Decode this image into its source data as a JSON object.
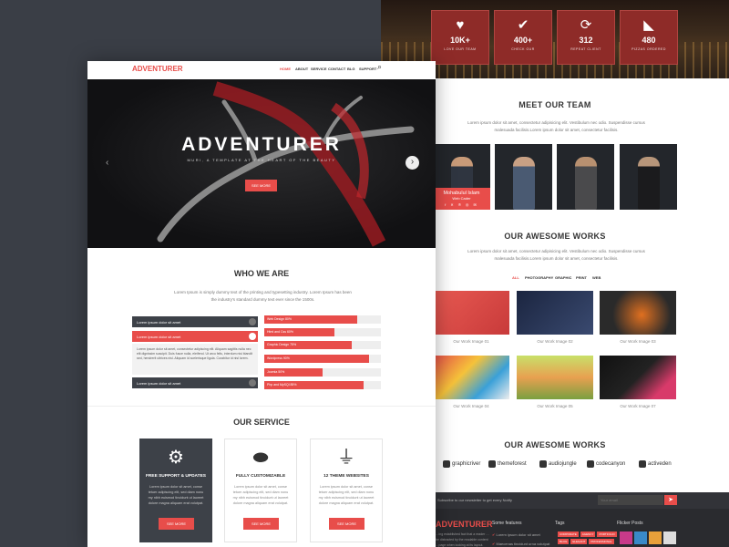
{
  "stats": [
    {
      "icon": "heart-icon",
      "glyph": "♥",
      "value": "10K+",
      "label": "LOVE OUR TEAM"
    },
    {
      "icon": "check-icon",
      "glyph": "✔",
      "value": "400+",
      "label": "CHECK OUR"
    },
    {
      "icon": "refresh-icon",
      "glyph": "⟳",
      "value": "312",
      "label": "REPEAT CLIENT"
    },
    {
      "icon": "pizza-icon",
      "glyph": "◣",
      "value": "480",
      "label": "PIZZAS ORDERED"
    }
  ],
  "team": {
    "title": "MEET OUR TEAM",
    "text": "Lorem ipsum dolor sit amet, consectetur adipisicing elit. Vestibulum nec odio. Suspendisse cursus malesuada facilisis.Lorem ipsum dolor sit amet, consectetur facilisis.",
    "featured_name": "Mohabulul Islam",
    "featured_role": "Web Cader",
    "featured_social": "f ✕ ℗ ◎ ✉"
  },
  "works": {
    "title": "OUR AWESOME WORKS",
    "text": "Lorem ipsum dolor sit amet, consectetur adipisicing elit. Vestibulum nec odio. Suspendisse cursus malesuada facilisis.Lorem ipsum dolor sit amet, consectetur facilisis.",
    "filters": [
      "ALL",
      "PHOTOGRAPHY",
      "GRAPHIC",
      "PRINT",
      "WEB"
    ],
    "items": [
      "Our Work Image 01",
      "Our Work Image 02",
      "Our Work Image 03",
      "Our Work Image 04",
      "Our Work Image 05",
      "Our Work Image 07"
    ]
  },
  "brands": {
    "title": "OUR AWESOME WORKS",
    "items": [
      "graphicriver",
      "themeforest",
      "audiojungle",
      "codecanyon",
      "activeden"
    ]
  },
  "footer": {
    "newsletter_text": "Subscribe to our newsletter to get every Notify",
    "email_placeholder": "Your email",
    "logo": "ADVENTURER",
    "about": "…ing established fact that a reader …be distracted by the readable content …page when looking at its layout.",
    "col_features": "Some features",
    "feature_items": [
      "Lorem ipsum dolor sit amet",
      "Maecenas tincidunt urna volutpat"
    ],
    "col_tags": "Tags",
    "tags": [
      "CORPORATE",
      "AGENCY",
      "PORTFOLIO",
      "BLOG",
      "ELEGANT",
      "PROFESSIONAL"
    ],
    "col_flickr": "Flicker Posts"
  },
  "nav": {
    "logo": "ADVENTURER",
    "items": [
      "HOME",
      "ABOUT",
      "SERVICE",
      "CONTACT",
      "BLG",
      "SUPPORT"
    ]
  },
  "hero": {
    "title": "ADVENTURER",
    "subtitle": "MURI, A TEMPLATE AT THE HEART OF THE BEAUTY",
    "button": "SEE MORE"
  },
  "who": {
    "title": "WHO WE ARE",
    "text": "Lorem Ipsum is simply dummy text of the printing and typesetting industry. Lorem Ipsum has been the industry's standard dummy text ever since the 1500s.",
    "accordion": [
      "Lorem ipsum dolor sit amet",
      "Lorem ipsum dolor sit amet",
      "Lorem ipsum dolor sit amet"
    ],
    "accordion_body": "Lorem ipsum dolor sit amet, consectetur adipiscing elit. Aliquam sagittis nulla nec elit dignissim suscipit. Duis fusce nulla, eleifend. Ut arcu felis, interdum nisi blandit sed, hendrerit ultrices nisl. Aliquam id scelerisque ligula. Curabitur id nisl lorem.",
    "skills": [
      {
        "label": "Web Design 80%",
        "pct": 80
      },
      {
        "label": "Html and Css 60%",
        "pct": 60
      },
      {
        "label": "Graphic Design 75%",
        "pct": 75
      },
      {
        "label": "Wordpress 90%",
        "pct": 90
      },
      {
        "label": "Joomla 50%",
        "pct": 50
      },
      {
        "label": "Php and MySQl 85%",
        "pct": 85
      }
    ]
  },
  "service": {
    "title": "OUR SERVICE",
    "items": [
      {
        "icon": "gear-icon",
        "glyph": "⚙",
        "title": "FREE SUPPORT & UPDATES",
        "text": "Lorem ipsum dolor sit amet, conse tetuer adipiscing elit, sed diam nonu my nibh euismod tincidunt ut laoreet dolore magna aliquam erat volutpat.",
        "button": "SEE MORE"
      },
      {
        "icon": "pill-icon",
        "glyph": "⬬",
        "title": "FULLY CUSTOMIZABLE",
        "text": "Lorem ipsum dolor sit amet, conse tetuer adipiscing elit, sed diam nonu my nibh euismod tincidunt ut laoreet dolore magna aliquam erat volutpat.",
        "button": "SEE MORE"
      },
      {
        "icon": "plug-icon",
        "glyph": "⏚",
        "title": "12 THEME WEBSITES",
        "text": "Lorem ipsum dolor sit amet, conse tetuer adipiscing elit, sed diam nonu my nibh euismod tincidunt ut laoreet dolore magna aliquam erat volutpat.",
        "button": "SEE MORE"
      }
    ]
  },
  "colors": {
    "accent": "#e84d4a",
    "dark": "#3d4148",
    "bg": "#3a3e46"
  }
}
